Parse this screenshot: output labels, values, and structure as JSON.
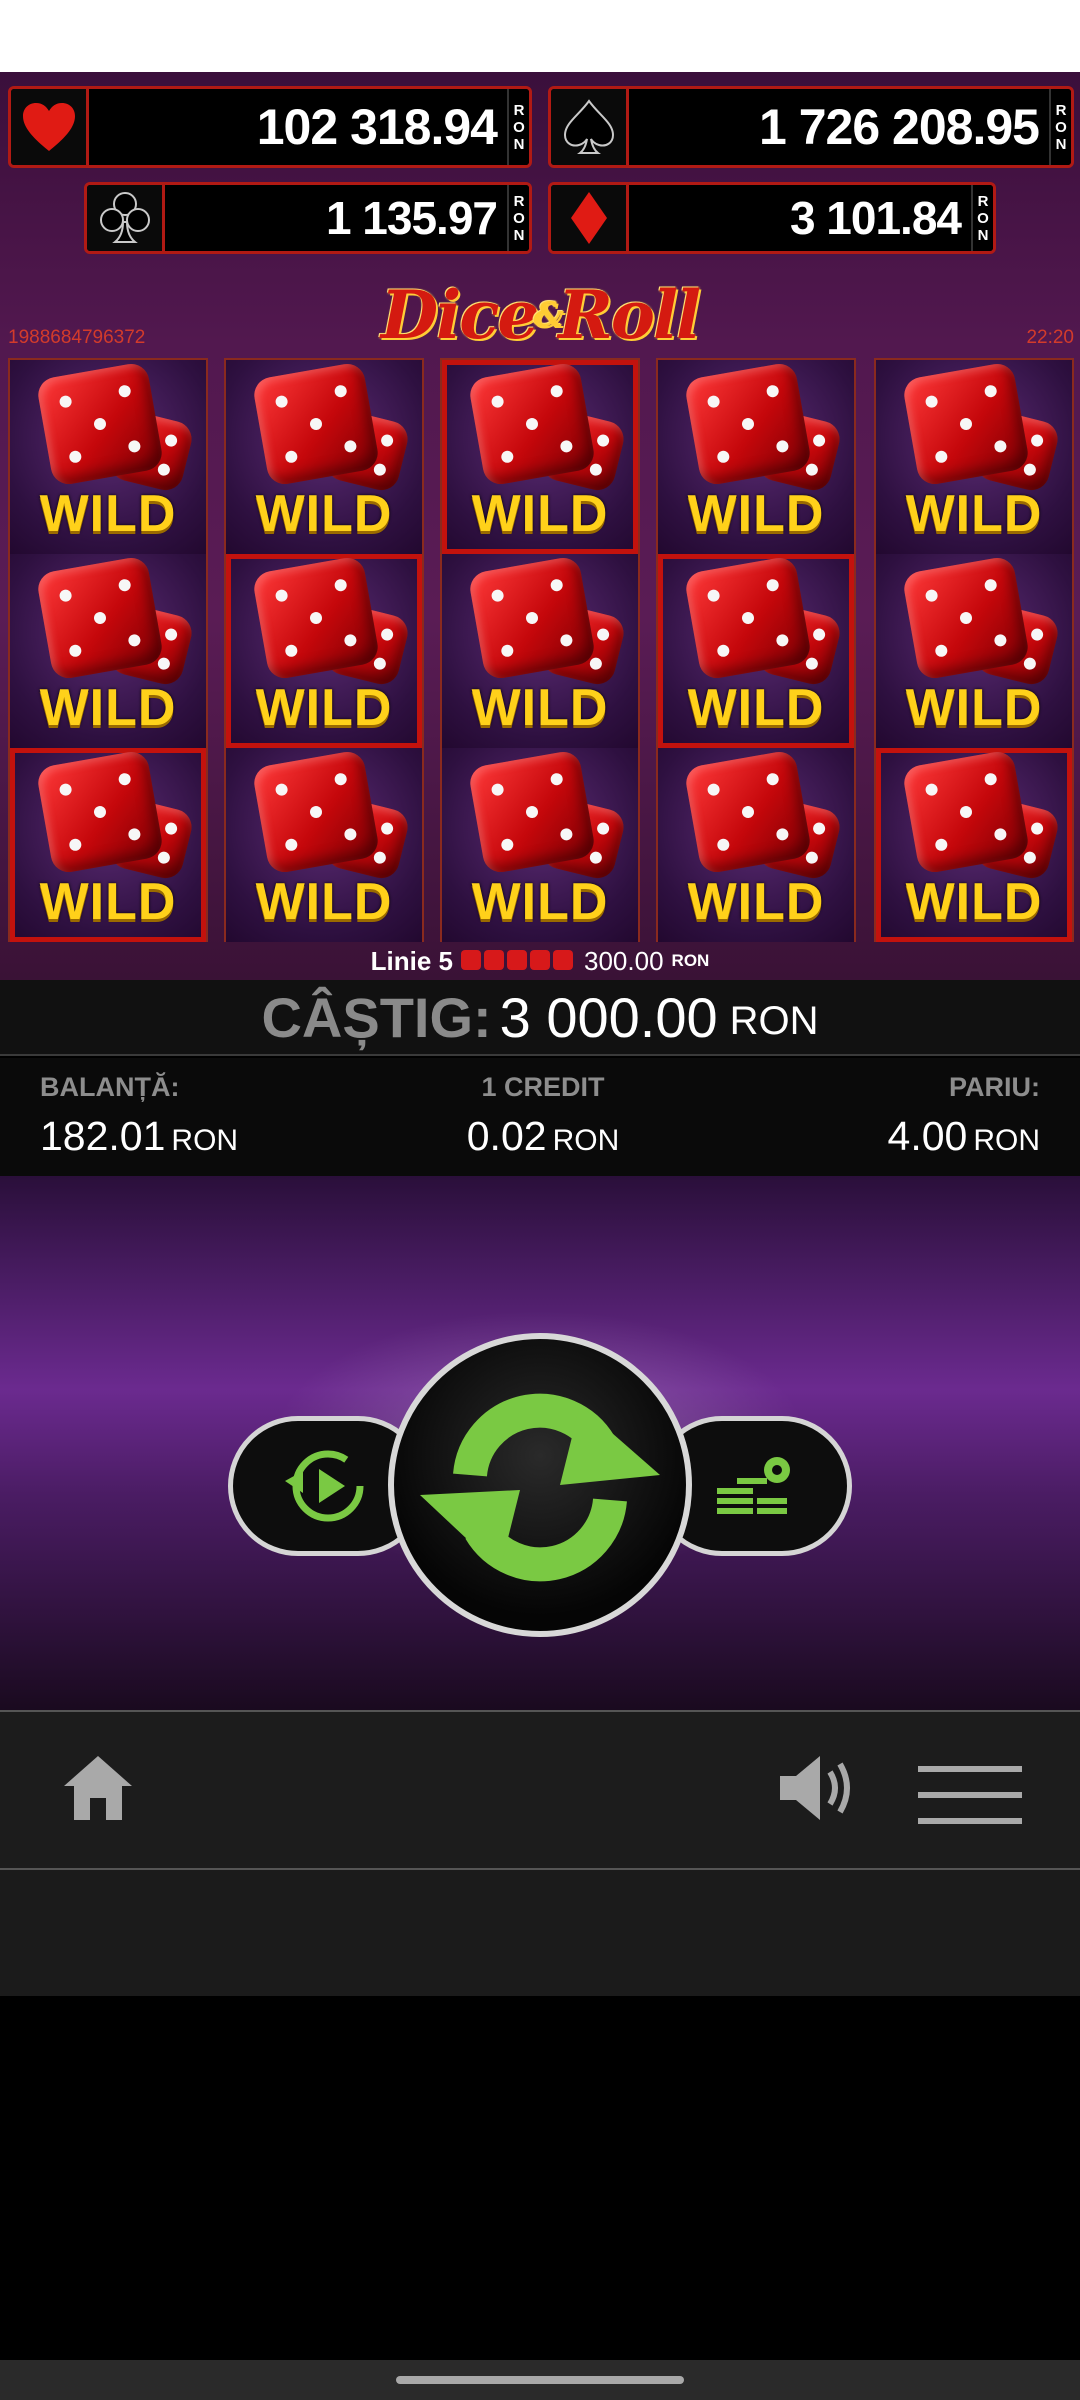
{
  "jackpots": [
    {
      "suit": "heart-icon",
      "amount": "102 318.94",
      "currency": "RON"
    },
    {
      "suit": "spade-icon",
      "amount": "1 726 208.95",
      "currency": "RON"
    },
    {
      "suit": "club-icon",
      "amount": "1 135.97",
      "currency": "RON"
    },
    {
      "suit": "diamond-icon",
      "amount": "3 101.84",
      "currency": "RON"
    }
  ],
  "logo": {
    "part1": "Dice",
    "amp": "&",
    "part2": "Roll"
  },
  "game_id": "1988684796372",
  "clock": "22:20",
  "reels": {
    "symbol": "WILD",
    "winning_cells": [
      [
        0,
        2
      ],
      [
        1,
        1
      ],
      [
        2,
        0
      ],
      [
        3,
        1
      ],
      [
        4,
        2
      ]
    ]
  },
  "line_win": {
    "label": "Linie 5",
    "amount": "300.00",
    "currency": "RON"
  },
  "win": {
    "label": "CÂȘTIG:",
    "value": "3 000.00",
    "currency": "RON"
  },
  "info": {
    "balance_label": "BALANȚĂ:",
    "balance_value": "182.01",
    "balance_currency": "RON",
    "credit_label": "1 CREDIT",
    "credit_value": "0.02",
    "credit_currency": "RON",
    "bet_label": "PARIU:",
    "bet_value": "4.00",
    "bet_currency": "RON"
  },
  "colors": {
    "accent_green": "#7ac943",
    "jackpot_border": "#b11a14",
    "wild_yellow": "#ffd11a"
  }
}
